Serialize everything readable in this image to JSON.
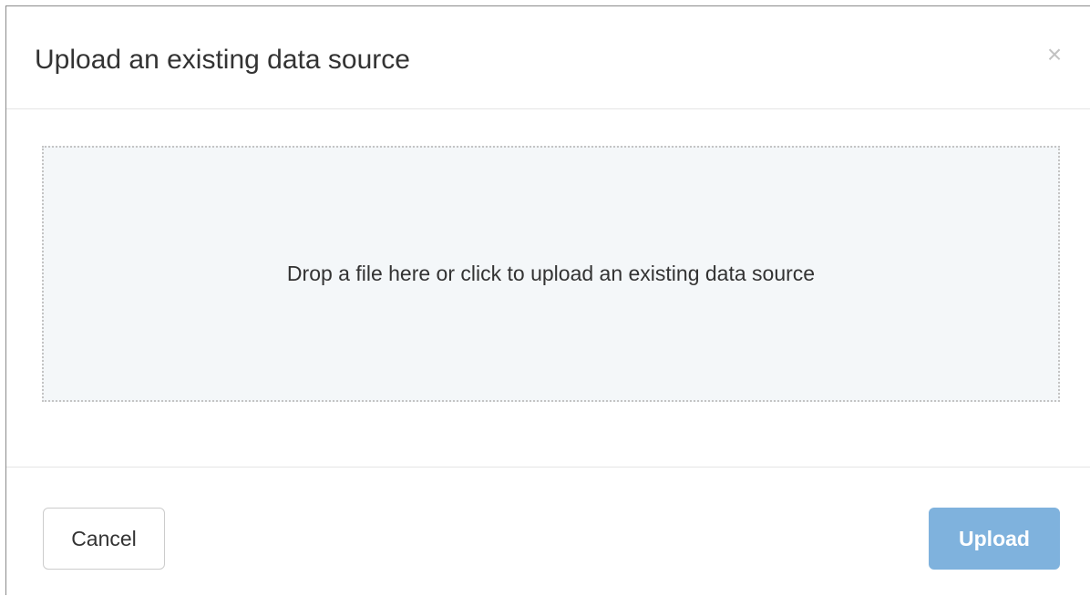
{
  "modal": {
    "title": "Upload an existing data source",
    "close_glyph": "×",
    "close_icon": "close-icon"
  },
  "dropzone": {
    "text": "Drop a file here or click to upload an existing data source"
  },
  "footer": {
    "cancel_label": "Cancel",
    "upload_label": "Upload",
    "upload_state": "disabled"
  },
  "colors": {
    "upload_button_bg": "#7fb2dd",
    "dropzone_bg": "#f4f7f9",
    "dropzone_border": "#c4c4c4"
  }
}
